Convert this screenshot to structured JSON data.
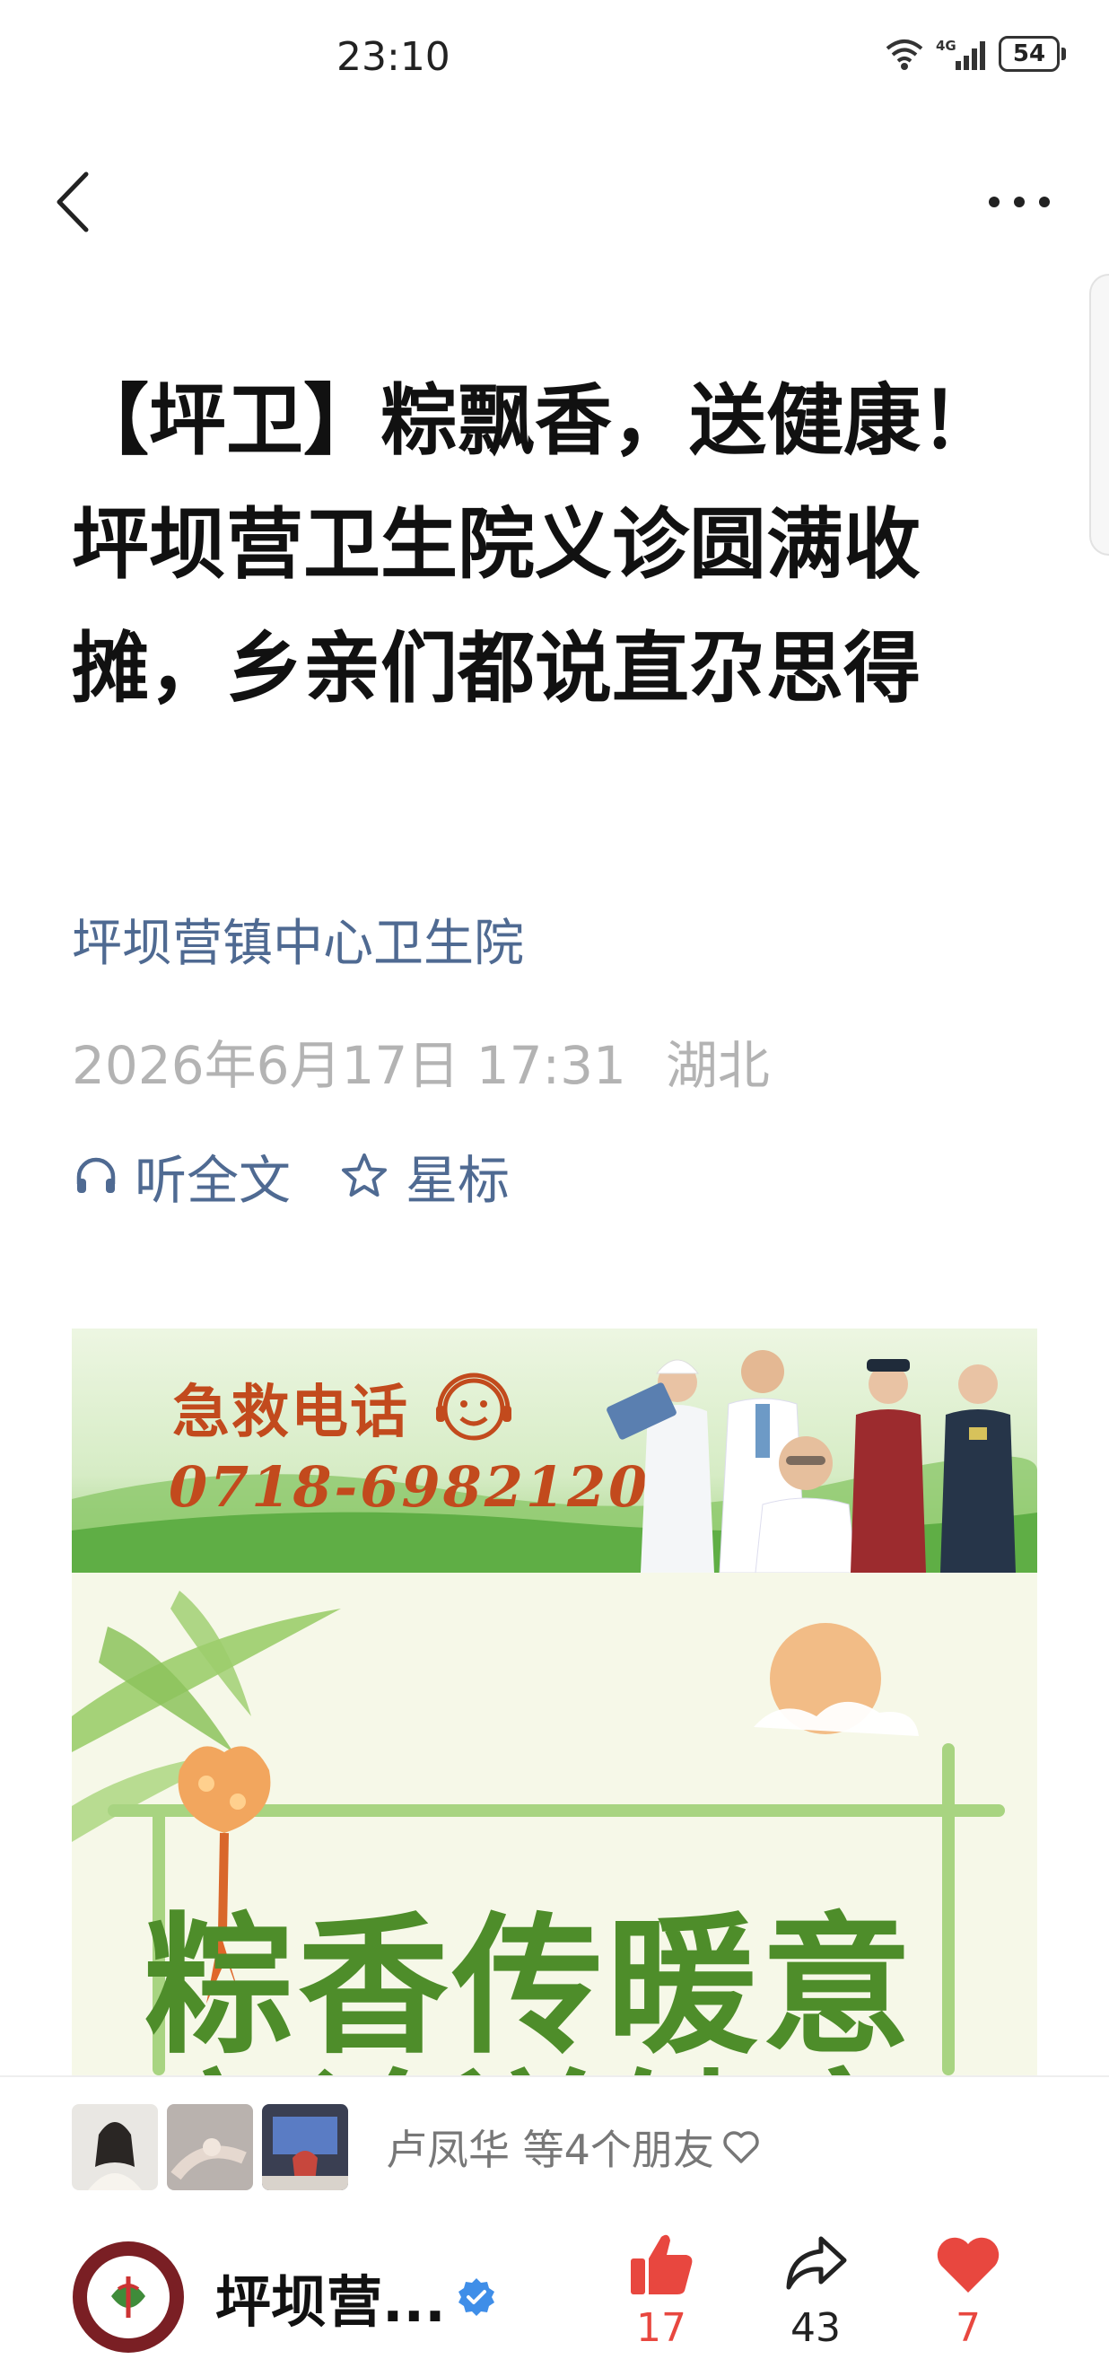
{
  "status": {
    "time": "23:10",
    "battery": "54"
  },
  "article": {
    "title": "【坪卫】粽飘香，送健康！坪坝营卫生院义诊圆满收摊，乡亲们都说直尕思得",
    "account": "坪坝营镇中心卫生院",
    "date": "2026年6月17日 17:31",
    "region": "湖北",
    "listen_label": "听全文",
    "star_label": "星标"
  },
  "banner": {
    "title": "急救电话",
    "phone": "0718-6982120"
  },
  "poster": {
    "headline": "粽香传暖意",
    "headline2": "义诊送健康"
  },
  "bottom": {
    "friends_text": "卢凤华 等4个朋友",
    "account_short": "坪坝营...",
    "likes": "17",
    "shares": "43",
    "hearts": "7"
  },
  "colors": {
    "link": "#4f6a92",
    "like": "#e8473f",
    "poster_green": "#4e8d2a",
    "banner_red": "#c24a1d"
  },
  "icons": [
    "back-arrow-icon",
    "more-dots-icon",
    "headphones-icon",
    "star-icon",
    "heart-outline-icon",
    "thumbs-up-icon",
    "share-icon",
    "heart-icon",
    "verified-icon"
  ]
}
